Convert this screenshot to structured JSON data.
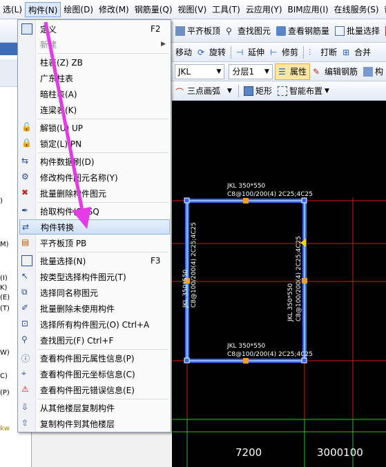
{
  "menubar": {
    "items": [
      "选(L)",
      "构件(N)",
      "绘图(D)",
      "修改(M)",
      "钢筋量(Q)",
      "视图(V)",
      "工具(T)",
      "云应用(Y)",
      "BIM应用(I)",
      "在线服务(S)",
      "帮"
    ]
  },
  "toolbar1": {
    "flat_board_top": "平齐板顶",
    "find_element": "查找图元",
    "view_rebar": "查看钢筋量",
    "batch_select": "批量选择",
    "rebar3d": "钢"
  },
  "toolbar2": {
    "move": "移动",
    "rotate": "旋转",
    "extend": "延伸",
    "trim": "修剪",
    "break": "打断",
    "merge": "合并"
  },
  "toolbar3": {
    "type_value": "JKL",
    "layer_value": "分层1",
    "properties": "属性",
    "edit_rebar": "编辑钢筋",
    "parts": "构"
  },
  "toolbar4": {
    "arc": "三点画弧",
    "rect": "矩形",
    "smart_place": "智能布置"
  },
  "left_panel": {
    "fragments": [
      ")",
      "M)",
      "(I)",
      "K)",
      "(E)",
      "(T)",
      "W)",
      "C)",
      "(P)",
      "kw"
    ]
  },
  "context_menu": {
    "items": [
      {
        "label": "定义",
        "shortcut": "F2",
        "disabled": false
      },
      {
        "label": "新建",
        "shortcut": "",
        "disabled": true
      },
      {
        "label": "柱表(Z)   ZB",
        "shortcut": "",
        "disabled": false
      },
      {
        "label": "广东柱表",
        "shortcut": "",
        "disabled": false
      },
      {
        "label": "暗柱表(A)",
        "shortcut": "",
        "disabled": false
      },
      {
        "label": "连梁表(K)",
        "shortcut": "",
        "disabled": false
      },
      {
        "label": "解锁(U)   UP",
        "shortcut": "",
        "disabled": false
      },
      {
        "label": "锁定(L)   PN",
        "shortcut": "",
        "disabled": false
      },
      {
        "label": "构件数据刷(D)",
        "shortcut": "",
        "disabled": false
      },
      {
        "label": "修改构件图元名称(Y)",
        "shortcut": "",
        "disabled": false
      },
      {
        "label": "批量删除构件图元",
        "shortcut": "",
        "disabled": false
      },
      {
        "label": "拾取构件(S)   SQ",
        "shortcut": "",
        "disabled": false
      },
      {
        "label": "构件转换",
        "shortcut": "",
        "disabled": false
      },
      {
        "label": "平齐板顶    PB",
        "shortcut": "",
        "disabled": false
      },
      {
        "label": "批量选择(N)",
        "shortcut": "F3",
        "disabled": false
      },
      {
        "label": "按类型选择构件图元(T)",
        "shortcut": "",
        "disabled": false
      },
      {
        "label": "选择同名称图元",
        "shortcut": "",
        "disabled": false
      },
      {
        "label": "批量删除未使用构件",
        "shortcut": "",
        "disabled": false
      },
      {
        "label": "选择所有构件图元(O)   Ctrl+A",
        "shortcut": "",
        "disabled": false
      },
      {
        "label": "查找图元(F)    Ctrl+F",
        "shortcut": "",
        "disabled": false
      },
      {
        "label": "查看构件图元属性信息(P)",
        "shortcut": "",
        "disabled": false
      },
      {
        "label": "查看构件图元坐标信息(C)",
        "shortcut": "",
        "disabled": false
      },
      {
        "label": "查看构件图元错误信息(E)",
        "shortcut": "",
        "disabled": false
      },
      {
        "label": "从其他楼层复制构件",
        "shortcut": "",
        "disabled": false
      },
      {
        "label": "复制构件到其他楼层",
        "shortcut": "",
        "disabled": false
      }
    ]
  },
  "canvas": {
    "beam_top_label1": "JKL 350*550",
    "beam_top_label2": "C8@100/200(4) 2C25;4C25",
    "beam_bottom_label1": "JKL 350*550",
    "beam_bottom_label2": "C8@100/200(4) 2C25;4C25",
    "beam_left_label1": "JKL 350*550",
    "beam_left_label2": "C8@100/200(4) 2C25;4C25",
    "beam_right_label1": "JKL 350*550",
    "beam_right_label2": "C8@100/200(4) 2C25;4C25",
    "dim1": "7200",
    "dim2": "3000100"
  },
  "colors": {
    "highlight_arrow": "#e33be6",
    "beam_blue": "#2e6cff",
    "grid_red": "#d21a1a",
    "dim_green": "#25c72a",
    "grip_orange": "#f0a020"
  }
}
